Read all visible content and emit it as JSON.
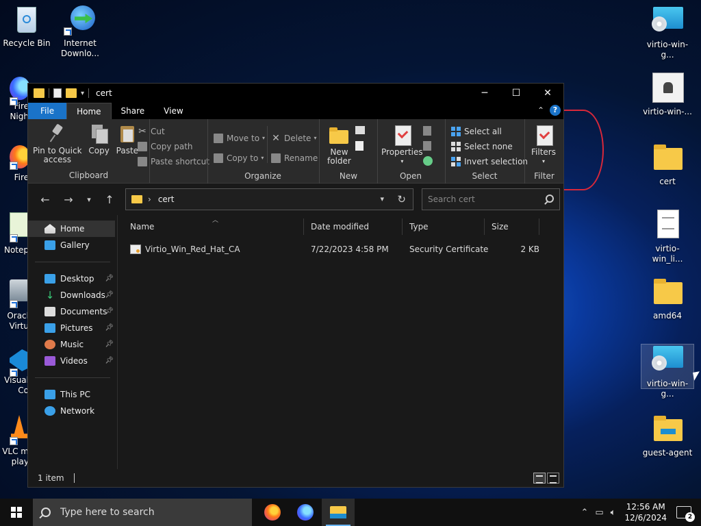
{
  "desktop": {
    "left_icons": [
      {
        "label": "Recycle Bin",
        "icon": "recycle-bin-icon"
      },
      {
        "label": "Internet\nDownlo...",
        "icon": "internet-download-manager-icon"
      },
      {
        "label": "Fire\nNigh",
        "icon": "firefox-nightly-icon"
      },
      {
        "label": "Fire",
        "icon": "firefox-icon"
      },
      {
        "label": "Notep",
        "icon": "notepad-icon"
      },
      {
        "label": "Oracl\nVirtu",
        "icon": "virtualbox-icon"
      },
      {
        "label": "Visual\nCo",
        "icon": "vscode-icon"
      },
      {
        "label": "VLC m\nplay",
        "icon": "vlc-icon"
      }
    ],
    "right_icons": [
      {
        "label": "virtio-win-g...",
        "icon": "disc-image-icon"
      },
      {
        "label": "virtio-win-...",
        "icon": "installer-icon"
      },
      {
        "label": "cert",
        "icon": "folder-icon"
      },
      {
        "label": "virtio-win_li...",
        "icon": "text-document-icon"
      },
      {
        "label": "amd64",
        "icon": "folder-icon"
      },
      {
        "label": "virtio-win-g...",
        "icon": "disc-image-icon"
      },
      {
        "label": "guest-agent",
        "icon": "folder-icon"
      }
    ]
  },
  "window": {
    "title": "cert",
    "controls": {
      "minimize": "─",
      "maximize": "☐",
      "close": "✕"
    },
    "tabs": {
      "file": "File",
      "home": "Home",
      "share": "Share",
      "view": "View"
    },
    "ribbon": {
      "clipboard": {
        "label": "Clipboard",
        "pin": "Pin to Quick\naccess",
        "copy": "Copy",
        "paste": "Paste",
        "cut": "Cut",
        "copy_path": "Copy path",
        "paste_shortcut": "Paste shortcut"
      },
      "organize": {
        "label": "Organize",
        "move_to": "Move to",
        "copy_to": "Copy to",
        "delete": "Delete",
        "rename": "Rename"
      },
      "new": {
        "label": "New",
        "new_folder": "New\nfolder"
      },
      "open": {
        "label": "Open",
        "properties": "Properties"
      },
      "select": {
        "label": "Select",
        "select_all": "Select all",
        "select_none": "Select none",
        "invert": "Invert selection"
      },
      "filter": {
        "label": "Filter",
        "filters": "Filters"
      }
    },
    "address": {
      "path": "cert",
      "separator": "›"
    },
    "search": {
      "placeholder": "Search cert"
    },
    "nav_pane": {
      "home": "Home",
      "gallery": "Gallery",
      "quick": [
        "Desktop",
        "Downloads",
        "Documents",
        "Pictures",
        "Music",
        "Videos"
      ],
      "this_pc": "This PC",
      "network": "Network"
    },
    "columns": {
      "name": "Name",
      "date": "Date modified",
      "type": "Type",
      "size": "Size"
    },
    "files": [
      {
        "name": "Virtio_Win_Red_Hat_CA",
        "date": "7/22/2023 4:58 PM",
        "type": "Security Certificate",
        "size": "2 KB"
      }
    ],
    "status": {
      "count": "1 item"
    }
  },
  "taskbar": {
    "search_placeholder": "Type here to search",
    "time": "12:56 AM",
    "date": "12/6/2024",
    "notification_count": "2"
  },
  "colors": {
    "accent": "#1a73c8",
    "folder": "#f7c948",
    "annotation": "#d8283a"
  }
}
